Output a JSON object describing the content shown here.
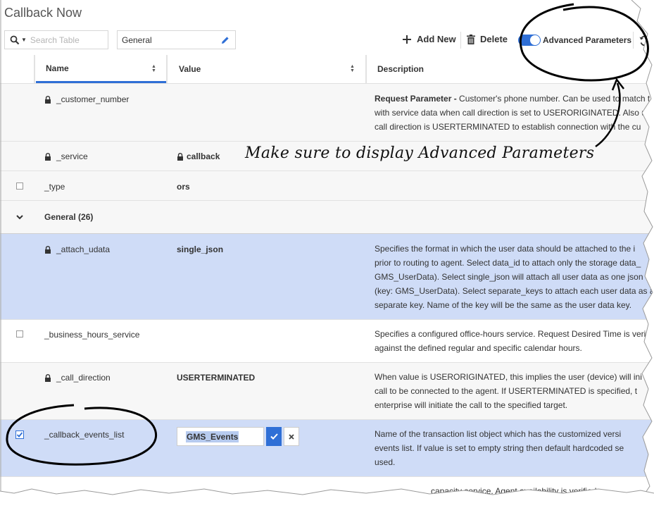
{
  "page": {
    "title": "Callback Now"
  },
  "toolbar": {
    "search_placeholder": "Search Table",
    "group_value": "General",
    "add_new_label": "Add New",
    "delete_label": "Delete",
    "advanced_label": "Advanced Parameters",
    "advanced_on": true
  },
  "table": {
    "columns": {
      "name": "Name",
      "value": "Value",
      "description": "Description"
    },
    "rows": [
      {
        "name": "_customer_number",
        "value": "",
        "desc_bold": "Request Parameter -",
        "desc": [
          " Customer's phone number. Can be used to match t",
          "with service data when call direction is set to USERORIGINATED. Also u",
          "call direction is USERTERMINATED to establish connection with the cu"
        ]
      },
      {
        "name": "_service",
        "value": "callback",
        "desc": []
      },
      {
        "name": "_type",
        "value": "ors",
        "desc": []
      },
      {
        "name": "_attach_udata",
        "value": "single_json",
        "desc": [
          "Specifies the format in which the user data should be attached to the i",
          "prior to routing to agent. Select data_id to attach only the storage data_",
          "GMS_UserData). Select single_json will attach all user data as one json o",
          "(key: GMS_UserData). Select separate_keys to attach each user data as a",
          "separate key. Name of the key will be the same as the user data key."
        ]
      },
      {
        "name": "_business_hours_service",
        "value": "",
        "desc": [
          "Specifies a configured office-hours service. Request Desired Time is verif",
          "against the defined regular and specific calendar hours."
        ]
      },
      {
        "name": "_call_direction",
        "value": "USERTERMINATED",
        "desc": [
          "When value is USERORIGINATED, this implies the user (device) will ini",
          "call to be connected to the agent. If USERTERMINATED is specified, t",
          "enterprise will initiate the call to the specified target."
        ]
      },
      {
        "name": "_callback_events_list",
        "value": "GMS_Events",
        "desc": [
          "Name of the transaction list object which has the customized versi",
          "events list. If value is set to empty string then default hardcoded se",
          "used."
        ]
      },
      {
        "desc": [
          "capacity service. Agent availability is verified a"
        ]
      }
    ],
    "group": {
      "label": "General (26)"
    }
  },
  "annotation": {
    "text": "Make sure to display Advanced Parameters"
  }
}
